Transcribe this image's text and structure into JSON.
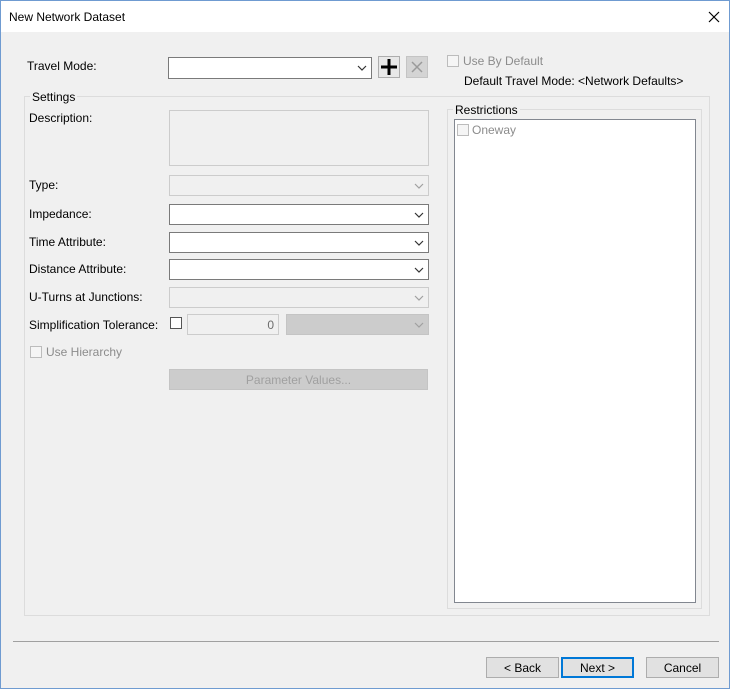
{
  "window": {
    "title": "New Network Dataset"
  },
  "travel_mode": {
    "label": "Travel Mode:",
    "value": "",
    "use_by_default_label": "Use By Default",
    "default_text": "Default Travel Mode: <Network Defaults>"
  },
  "settings": {
    "legend": "Settings",
    "description_label": "Description:",
    "type_label": "Type:",
    "impedance_label": "Impedance:",
    "time_attribute_label": "Time Attribute:",
    "distance_attribute_label": "Distance Attribute:",
    "uturns_label": "U-Turns at Junctions:",
    "simplification_label": "Simplification Tolerance:",
    "simplification_value": "0",
    "use_hierarchy_label": "Use Hierarchy",
    "parameter_values_label": "Parameter Values..."
  },
  "restrictions": {
    "legend": "Restrictions",
    "items": [
      "Oneway"
    ]
  },
  "footer": {
    "back_label": "< Back",
    "next_label": "Next >",
    "cancel_label": "Cancel"
  }
}
